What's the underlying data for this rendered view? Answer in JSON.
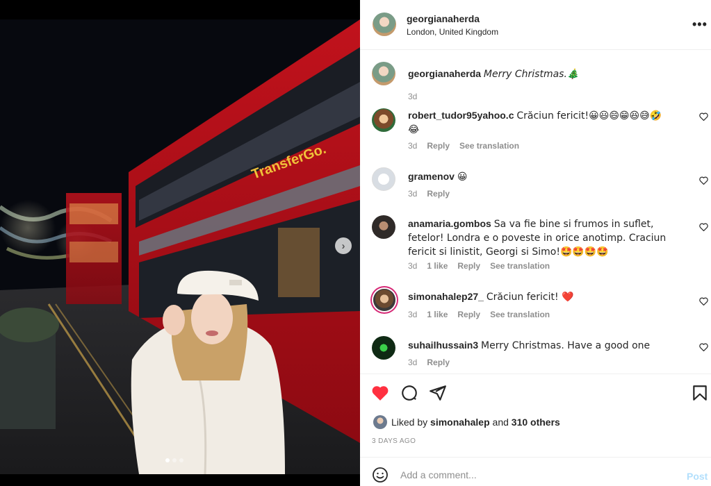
{
  "post": {
    "username": "georgianaherda",
    "location": "London, United Kingdom",
    "caption": "Merry Christmas.🎄",
    "caption_time": "3d"
  },
  "comments": [
    {
      "user": "robert_tudor95yahoo.c",
      "text": "Crăciun fericit!😀😃😄😁😆😅🤣",
      "text2": "😂",
      "time": "3d",
      "likes": "",
      "reply": "Reply",
      "translate": "See translation"
    },
    {
      "user": "gramenov",
      "text": "😀",
      "text2": "",
      "time": "3d",
      "likes": "",
      "reply": "Reply",
      "translate": ""
    },
    {
      "user": "anamaria.gombos",
      "text": "Sa va fie bine si frumos in suflet, fetelor! Londra e o poveste in orice anotimp. Craciun fericit si linistit, Georgi si Simo!🤩🤩🤩🤩",
      "text2": "",
      "time": "3d",
      "likes": "1 like",
      "reply": "Reply",
      "translate": "See translation"
    },
    {
      "user": "simonahalep27_",
      "text": "Crăciun fericit! ❤️",
      "text2": "",
      "time": "3d",
      "likes": "1 like",
      "reply": "Reply",
      "translate": "See translation"
    },
    {
      "user": "suhailhussain3",
      "text": "Merry Christmas. Have a good one",
      "text2": "",
      "time": "3d",
      "likes": "",
      "reply": "Reply",
      "translate": ""
    }
  ],
  "likes": {
    "prefix": "Liked by",
    "user": "simonahalep",
    "middle": "and",
    "others": "310 others"
  },
  "date": "3 DAYS AGO",
  "add_comment": {
    "placeholder": "Add a comment...",
    "post_label": "Post"
  },
  "icons": {
    "like": "heart-filled-icon",
    "comment": "comment-icon",
    "share": "paper-plane-icon",
    "save": "bookmark-icon",
    "more": "more-horizontal-icon",
    "emoji": "smiley-icon",
    "next": "chevron-right-icon"
  },
  "colors": {
    "like_red": "#ff3040",
    "post_disabled": "#b2dffc",
    "muted": "#8e8e8e",
    "story_ring": "#d62976"
  },
  "carousel": {
    "total": 3,
    "active": 1
  }
}
